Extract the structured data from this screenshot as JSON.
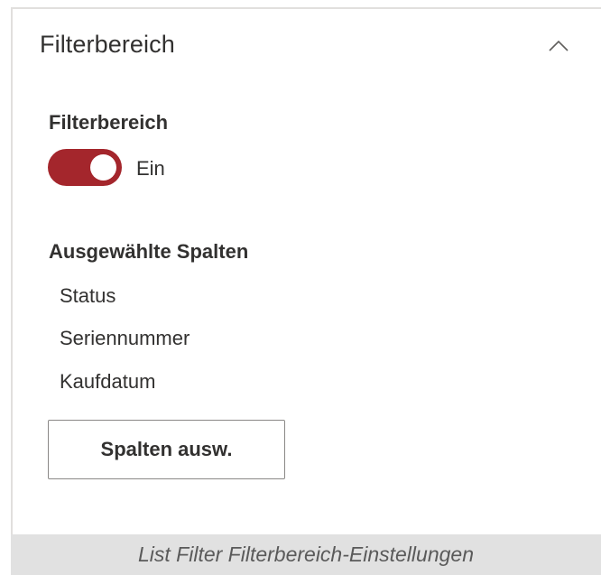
{
  "section": {
    "title": "Filterbereich",
    "collapse_icon": "chevron-up-icon"
  },
  "filter_pane": {
    "label": "Filterbereich",
    "toggle_state": "Ein",
    "toggle_on": true,
    "toggle_color": "#a4262c"
  },
  "selected_columns": {
    "label": "Ausgewählte Spalten",
    "items": [
      "Status",
      "Seriennummer",
      "Kaufdatum"
    ],
    "button_label": "Spalten ausw."
  },
  "caption": "List Filter Filterbereich-Einstellungen"
}
